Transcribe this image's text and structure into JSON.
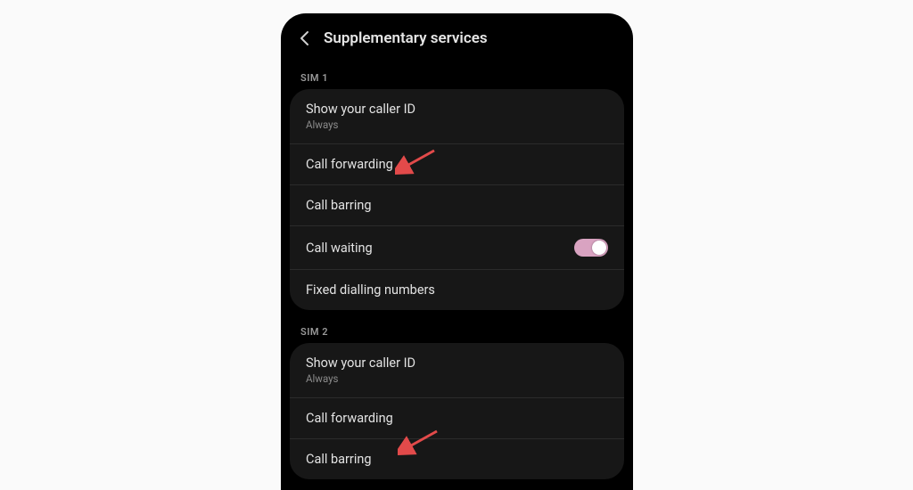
{
  "header": {
    "title": "Supplementary services"
  },
  "sections": [
    {
      "label": "SIM 1",
      "items": [
        {
          "title": "Show your caller ID",
          "subtitle": "Always"
        },
        {
          "title": "Call forwarding"
        },
        {
          "title": "Call barring"
        },
        {
          "title": "Call waiting",
          "toggle": true
        },
        {
          "title": "Fixed dialling numbers"
        }
      ]
    },
    {
      "label": "SIM 2",
      "items": [
        {
          "title": "Show your caller ID",
          "subtitle": "Always"
        },
        {
          "title": "Call forwarding"
        },
        {
          "title": "Call barring"
        }
      ]
    }
  ],
  "annotations": {
    "arrows_point_to": "Call forwarding",
    "arrow_color": "#e24a4a"
  },
  "colors": {
    "page_bg": "#fafafa",
    "phone_bg": "#000000",
    "card_bg": "#171717",
    "text": "#e3e3e3",
    "muted": "#8c8c8c",
    "toggle_on": "#d9a3c1"
  }
}
